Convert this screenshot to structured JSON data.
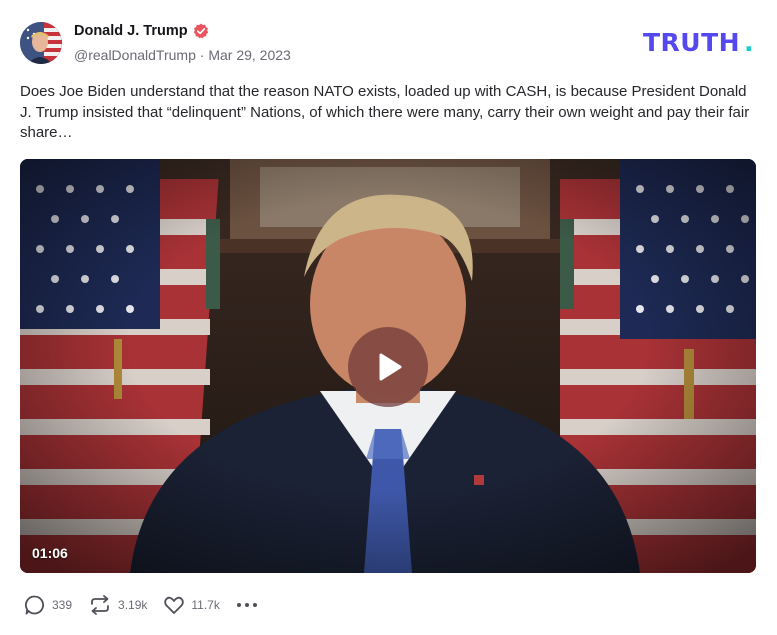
{
  "post": {
    "author_name": "Donald J. Trump",
    "handle": "@realDonaldTrump",
    "date": "Mar 29, 2023",
    "text": "Does Joe Biden understand that the reason NATO exists, loaded up with CASH, is because President Donald J. Trump insisted that “delinquent” Nations, of which there were many, carry their own weight and pay their fair share…"
  },
  "brand": {
    "logo_text": "TRUTH",
    "logo_dot": ".",
    "color": "#5448ee",
    "dot_color": "#13d0d0"
  },
  "video": {
    "duration": "01:06"
  },
  "actions": {
    "replies": "339",
    "retruths": "3.19k",
    "likes": "11.7k"
  },
  "icons": [
    "verified-badge-icon",
    "play-icon",
    "reply-icon",
    "retruth-icon",
    "like-icon",
    "more-icon"
  ],
  "colors": {
    "verified": "#e9545f",
    "text_muted": "#6b6b75"
  }
}
